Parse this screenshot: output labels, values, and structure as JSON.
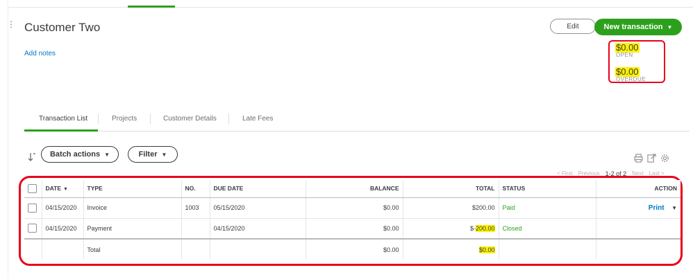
{
  "customer": {
    "name": "Customer Two",
    "add_notes": "Add notes"
  },
  "header": {
    "edit_label": "Edit",
    "new_transaction_label": "New transaction"
  },
  "summary": {
    "open_amount": "$0.00",
    "open_label": "OPEN",
    "overdue_amount": "$0.00",
    "overdue_label": "OVERDUE"
  },
  "tabs": [
    {
      "label": "Transaction List",
      "active": true
    },
    {
      "label": "Projects",
      "active": false
    },
    {
      "label": "Customer Details",
      "active": false
    },
    {
      "label": "Late Fees",
      "active": false
    }
  ],
  "toolbar": {
    "batch_actions": "Batch actions",
    "filter": "Filter"
  },
  "pager": {
    "first": "< First",
    "previous": "Previous",
    "range": "1-2 of 2",
    "next": "Next",
    "last": "Last >"
  },
  "table": {
    "columns": [
      "DATE",
      "TYPE",
      "NO.",
      "DUE DATE",
      "BALANCE",
      "TOTAL",
      "STATUS",
      "ACTION"
    ],
    "rows": [
      {
        "date": "04/15/2020",
        "type": "Invoice",
        "no": "1003",
        "due_date": "05/15/2020",
        "balance": "$0.00",
        "total": "$200.00",
        "status": "Paid",
        "action": "Print"
      },
      {
        "date": "04/15/2020",
        "type": "Payment",
        "no": "",
        "due_date": "04/15/2020",
        "balance": "$0.00",
        "total_prefix": "$-",
        "total_highlight": "200.00",
        "status": "Closed",
        "action": ""
      }
    ],
    "total_row": {
      "label": "Total",
      "balance": "$0.00",
      "total": "$0.00"
    }
  },
  "icons": [
    "print-icon",
    "export-icon",
    "settings-gear-icon",
    "sort-arrow-icon"
  ],
  "colors": {
    "accent_green": "#2ca01c",
    "link_blue": "#0077c5",
    "annotation_red": "#e8001c",
    "highlight_yellow": "#fff200"
  }
}
